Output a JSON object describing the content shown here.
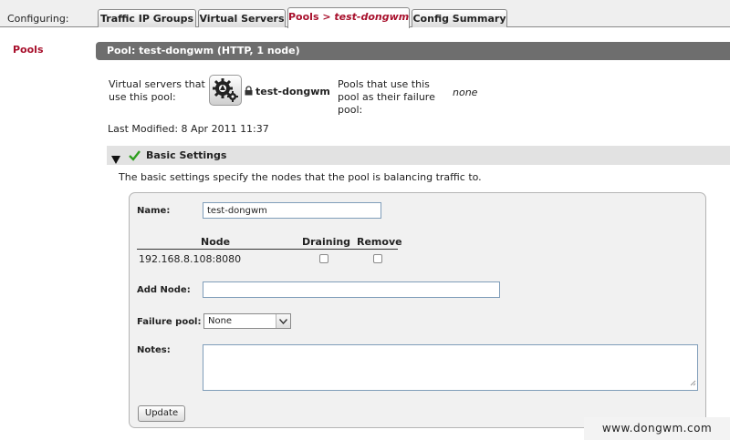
{
  "topbar": {
    "configuring_label": "Configuring:",
    "tabs": [
      {
        "label": "Traffic IP Groups",
        "extra": ""
      },
      {
        "label": "Virtual Servers",
        "extra": ""
      },
      {
        "label": "Pools > ",
        "extra": "test-dongwm"
      },
      {
        "label": "Config Summary",
        "extra": ""
      }
    ],
    "active_tab": 2
  },
  "leftnav": {
    "title": "Pools"
  },
  "pool": {
    "header": "Pool: test-dongwm (HTTP, 1 node)",
    "virtual_servers_label": "Virtual servers that use this pool:",
    "virtual_server_name": "test-dongwm",
    "failure_pool_label": "Pools that use this pool as their failure pool:",
    "failure_pool_value": "none",
    "last_modified": "Last Modified: 8 Apr 2011 11:37"
  },
  "basic_settings": {
    "title": "Basic Settings",
    "description": "The basic settings specify the nodes that the pool is balancing traffic to.",
    "name_label": "Name:",
    "name_value": "test-dongwm",
    "columns": {
      "node": "Node",
      "draining": "Draining",
      "remove": "Remove"
    },
    "nodes": [
      {
        "address": "192.168.8.108:8080",
        "draining": false,
        "remove": false
      }
    ],
    "add_node_label": "Add Node:",
    "add_node_value": "",
    "failure_pool_label": "Failure pool:",
    "failure_pool_selected": "None",
    "notes_label": "Notes:",
    "notes_value": "",
    "update_label": "Update"
  },
  "watermark": "www.dongwm.com",
  "colors": {
    "accent": "#a8102c",
    "header_bg": "#6e6e6e",
    "check": "#2e9e1e"
  }
}
